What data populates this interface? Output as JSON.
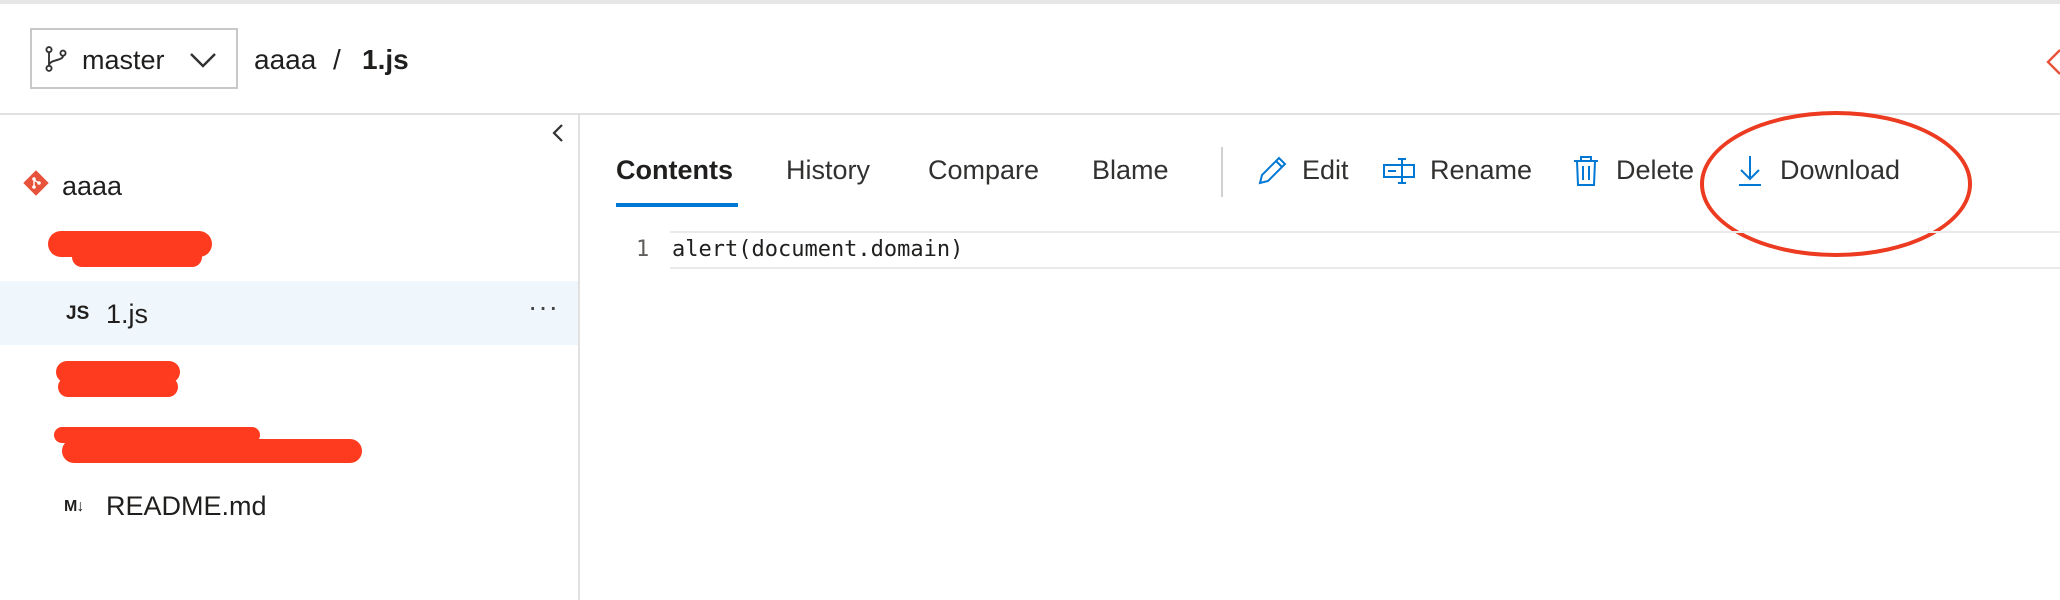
{
  "header": {
    "branch": {
      "name": "master",
      "icon": "branch-icon"
    },
    "breadcrumb": {
      "repo": "aaaa",
      "separator": "/",
      "file": "1.js"
    }
  },
  "sidebar": {
    "repo": {
      "label": "aaaa",
      "icon": "git-repo-icon",
      "color": "#e8523a"
    },
    "items": [
      {
        "label": "1.js",
        "icon": "JS",
        "selected": true,
        "more": "···"
      },
      {
        "label": "README.md",
        "icon": "M↓"
      }
    ]
  },
  "tabs": [
    {
      "label": "Contents",
      "active": true
    },
    {
      "label": "History"
    },
    {
      "label": "Compare"
    },
    {
      "label": "Blame"
    }
  ],
  "commands": {
    "edit": "Edit",
    "rename": "Rename",
    "delete": "Delete",
    "download": "Download"
  },
  "code": {
    "lines": [
      {
        "number": "1",
        "text": "alert(document.domain)"
      }
    ]
  },
  "colors": {
    "accent": "#0078d4",
    "selection": "#eff6fc",
    "annotation": "#ec3b20"
  }
}
